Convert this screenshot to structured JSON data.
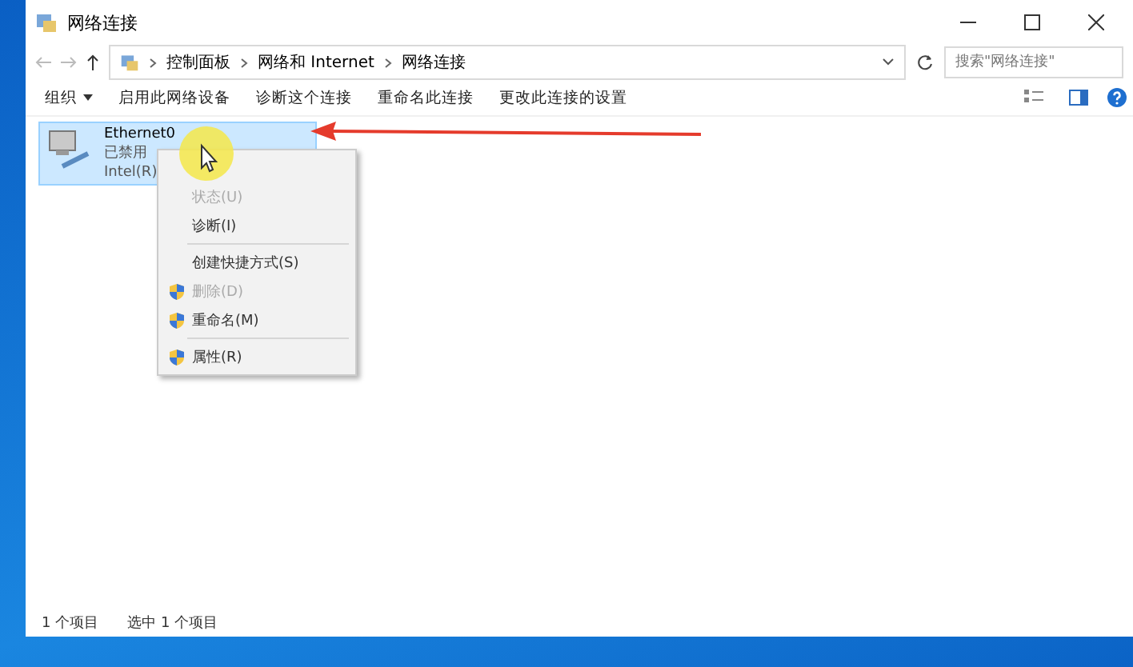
{
  "window": {
    "title": "网络连接"
  },
  "breadcrumb": [
    "控制面板",
    "网络和 Internet",
    "网络连接"
  ],
  "search": {
    "placeholder": "搜索\"网络连接\""
  },
  "toolbar": [
    {
      "label": "组织",
      "dropdown": true
    },
    {
      "label": "启用此网络设备",
      "dropdown": false
    },
    {
      "label": "诊断这个连接",
      "dropdown": false
    },
    {
      "label": "重命名此连接",
      "dropdown": false
    },
    {
      "label": "更改此连接的设置",
      "dropdown": false
    }
  ],
  "connection": {
    "name": "Ethernet0",
    "status": "已禁用",
    "device": "Intel(R)",
    "selected": true
  },
  "context_menu": [
    {
      "label": "状态(U)",
      "shield": false,
      "disabled": true,
      "separator_after": false
    },
    {
      "label": "诊断(I)",
      "shield": false,
      "disabled": false,
      "separator_after": true
    },
    {
      "label": "创建快捷方式(S)",
      "shield": false,
      "disabled": false,
      "separator_after": false
    },
    {
      "label": "删除(D)",
      "shield": true,
      "disabled": true,
      "separator_after": false
    },
    {
      "label": "重命名(M)",
      "shield": true,
      "disabled": false,
      "separator_after": true
    },
    {
      "label": "属性(R)",
      "shield": true,
      "disabled": false,
      "separator_after": false
    }
  ],
  "status_bar": [
    "1 个项目",
    "选中 1 个项目"
  ]
}
